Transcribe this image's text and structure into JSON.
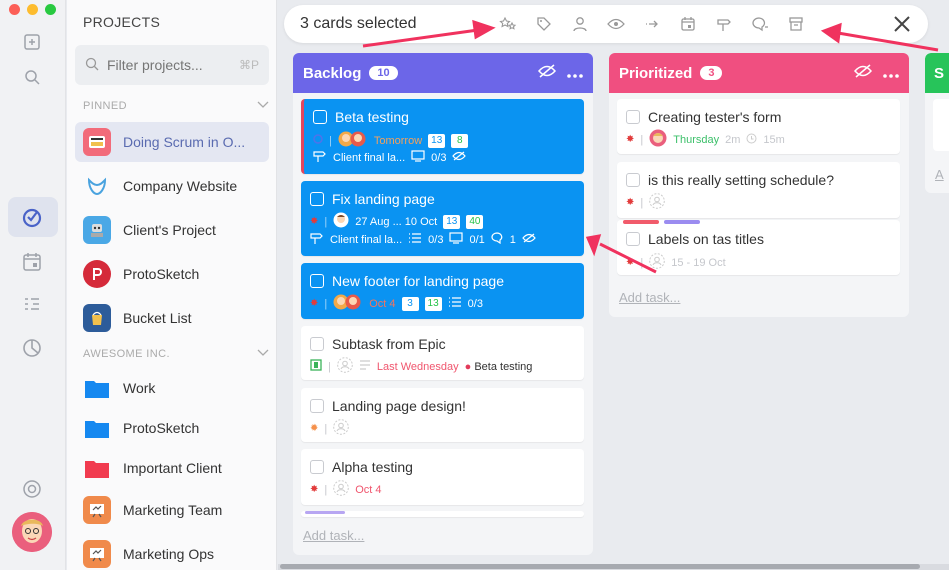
{
  "window": {
    "traffic_colors": [
      "#fc5f57",
      "#fdbc2e",
      "#28c940"
    ]
  },
  "sidebar": {
    "title": "PROJECTS",
    "filter": {
      "placeholder": "Filter projects...",
      "shortcut": "⌘P"
    },
    "pinned_label": "PINNED",
    "awesome_label": "AWESOME INC.",
    "pinned": [
      {
        "label": "Doing Scrum in O...",
        "icon": "scrum-icon",
        "active": true
      },
      {
        "label": "Company Website",
        "icon": "website-icon"
      },
      {
        "label": "Client's Project",
        "icon": "robot-icon"
      },
      {
        "label": "ProtoSketch",
        "icon": "protosketch-icon"
      },
      {
        "label": "Bucket List",
        "icon": "bucket-icon"
      }
    ],
    "awesome": [
      {
        "label": "Work",
        "icon": "folder-icon",
        "color": "#1588f0"
      },
      {
        "label": "ProtoSketch",
        "icon": "folder-icon",
        "color": "#1588f0"
      },
      {
        "label": "Important Client",
        "icon": "folder-icon",
        "color": "#f13b4f"
      },
      {
        "label": "Marketing Team",
        "icon": "board-icon"
      },
      {
        "label": "Marketing Ops",
        "icon": "board-icon"
      }
    ]
  },
  "selection_bar": {
    "label": "3 cards selected"
  },
  "columns": {
    "backlog": {
      "name": "Backlog",
      "count": "10",
      "color": "#6c66e8",
      "add_task": "Add task...",
      "cards": [
        {
          "title": "Beta testing",
          "date": "Tomorrow",
          "n1": "13",
          "n2": "8",
          "note": "Client final la...",
          "progress": "0/3"
        },
        {
          "title": "Fix landing page",
          "date": "27 Aug ... 10 Oct",
          "n1": "13",
          "n2": "40",
          "note": "Client final la...",
          "check": "0/3",
          "progress": "0/1",
          "comments": "1"
        },
        {
          "title": "New footer for landing page",
          "date": "Oct 4",
          "n1": "3",
          "n2": "13",
          "check": "0/3"
        },
        {
          "title": "Subtask from Epic",
          "date": "Last Wednesday",
          "epic": "Beta testing"
        },
        {
          "title": "Landing page design!"
        },
        {
          "title": "Alpha testing",
          "date": "Oct 4"
        }
      ]
    },
    "prioritized": {
      "name": "Prioritized",
      "count": "3",
      "color": "#f04f80",
      "add_task": "Add task...",
      "cards": [
        {
          "title": "Creating tester's form",
          "date": "Thursday",
          "time1": "2m",
          "time2": "15m"
        },
        {
          "title": "is this really setting schedule?"
        },
        {
          "title": "Labels on tas titles",
          "date": "15 - 19 Oct"
        }
      ]
    },
    "third": {
      "name": "S",
      "color": "#27c45a",
      "add_task": "A"
    }
  }
}
